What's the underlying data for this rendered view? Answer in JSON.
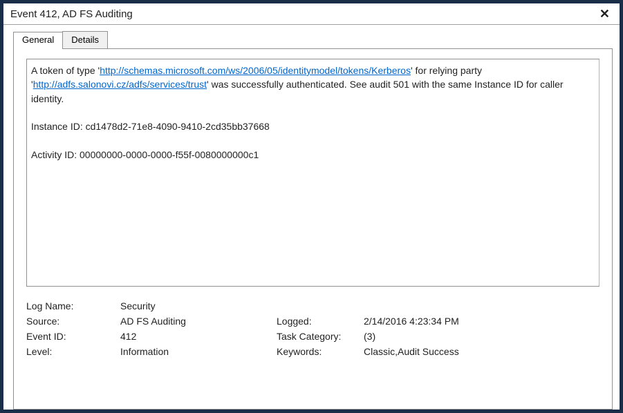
{
  "title": "Event 412, AD FS Auditing",
  "tabs": {
    "general": "General",
    "details": "Details"
  },
  "description": {
    "pre1": "A token of type '",
    "link1": "http://schemas.microsoft.com/ws/2006/05/identitymodel/tokens/Kerberos",
    "mid1": "' for relying party '",
    "link2": "http://adfs.salonovi.cz/adfs/services/trust",
    "post1": "' was successfully authenticated.  See audit 501 with the same Instance ID for caller identity.",
    "instance_line": "Instance ID: cd1478d2-71e8-4090-9410-2cd35bb37668",
    "activity_line": "Activity ID: 00000000-0000-0000-f55f-0080000000c1"
  },
  "properties": {
    "log_name_label": "Log Name:",
    "log_name": "Security",
    "source_label": "Source:",
    "source": "AD FS Auditing",
    "logged_label": "Logged:",
    "logged": "2/14/2016 4:23:34 PM",
    "event_id_label": "Event ID:",
    "event_id": "412",
    "task_category_label": "Task Category:",
    "task_category": "(3)",
    "level_label": "Level:",
    "level": "Information",
    "keywords_label": "Keywords:",
    "keywords": "Classic,Audit Success"
  }
}
